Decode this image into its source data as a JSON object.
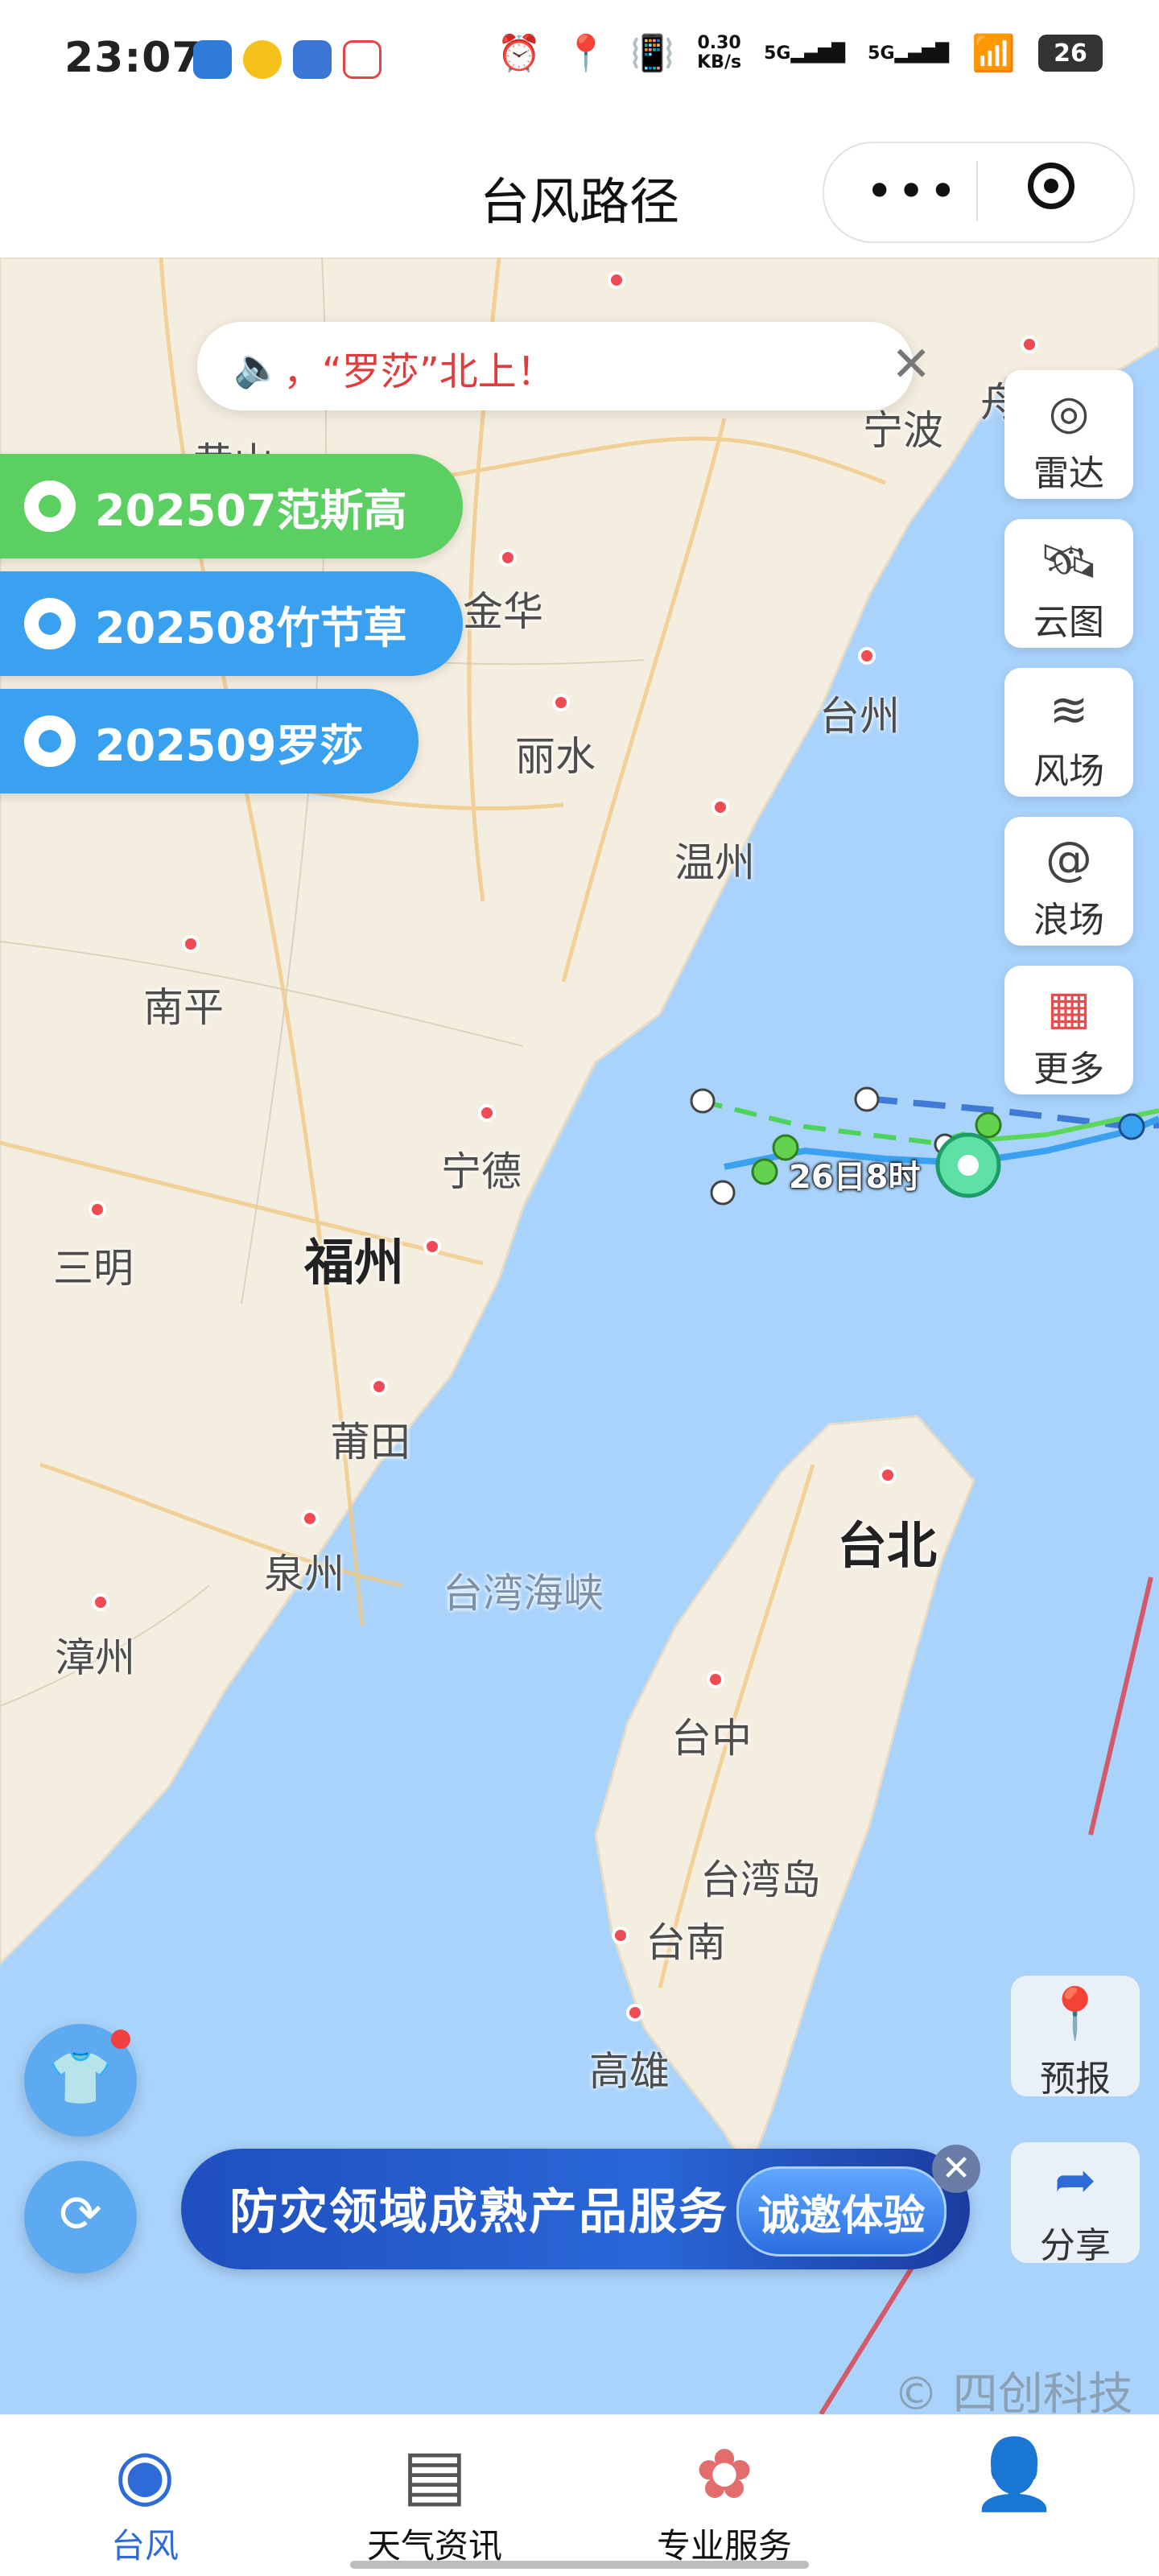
{
  "status_bar": {
    "time": "23:07",
    "net_speed_value": "0.30",
    "net_speed_unit": "KB/s",
    "signal_1": "5G",
    "signal_2": "5G",
    "battery": "26"
  },
  "header": {
    "title": "台风路径"
  },
  "notice": {
    "text": "，“罗莎”北上！"
  },
  "typhoons": [
    {
      "label": "202507范斯高",
      "color": "#58c95a"
    },
    {
      "label": "202508竹节草",
      "color": "#3aa0f0"
    },
    {
      "label": "202509罗莎",
      "color": "#3aa0f0"
    }
  ],
  "tools": [
    {
      "label": "雷达",
      "icon": "radar-icon"
    },
    {
      "label": "云图",
      "icon": "satellite-icon"
    },
    {
      "label": "风场",
      "icon": "wind-icon"
    },
    {
      "label": "浪场",
      "icon": "wave-icon"
    },
    {
      "label": "更多",
      "icon": "more-icon"
    }
  ],
  "map": {
    "cities": [
      {
        "name": "黄山"
      },
      {
        "name": "金华"
      },
      {
        "name": "丽水"
      },
      {
        "name": "温州"
      },
      {
        "name": "台州"
      },
      {
        "name": "宁波"
      },
      {
        "name": "舟山"
      },
      {
        "name": "南平"
      },
      {
        "name": "宁德"
      },
      {
        "name": "三明"
      },
      {
        "name": "福州"
      },
      {
        "name": "莆田"
      },
      {
        "name": "泉州"
      },
      {
        "name": "漳州"
      },
      {
        "name": "台北"
      },
      {
        "name": "台中"
      },
      {
        "name": "台湾岛"
      },
      {
        "name": "台南"
      },
      {
        "name": "高雄"
      },
      {
        "name": "台湾海峡"
      }
    ],
    "typhoon_time_label": "26日8时"
  },
  "side_actions": {
    "forecast": "预报",
    "share": "分享"
  },
  "ad": {
    "text": "防灾领域成熟产品服务",
    "button": "诚邀体验"
  },
  "copyright": "© 四创科技",
  "tabs": [
    {
      "label": "台风",
      "icon": "typhoon-icon"
    },
    {
      "label": "天气资讯",
      "icon": "news-icon"
    },
    {
      "label": "专业服务",
      "icon": "service-icon"
    },
    {
      "label": "",
      "icon": "user-icon"
    }
  ]
}
